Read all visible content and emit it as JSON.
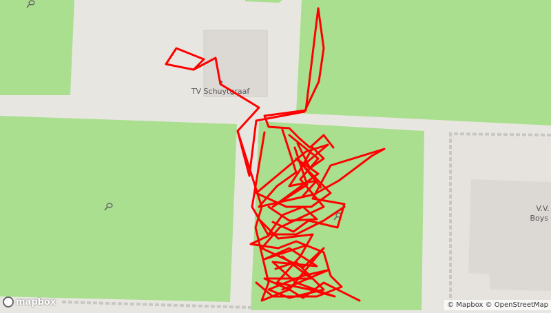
{
  "map": {
    "labels": {
      "club": "TV Schuytgraaf",
      "building": "V.V.",
      "building_2": "Boys S"
    },
    "colors": {
      "grass": "#aadf8f",
      "ground": "#e8e6e1",
      "building": "#dcd9d5",
      "track": "#ff0000",
      "fence": "#c9c7c3"
    },
    "icons": [
      "tennis-racket-icon",
      "tennis-racket-icon",
      "tennis-racket-icon",
      "poi-dot-icon"
    ],
    "attribution": "© Mapbox © OpenStreetMap",
    "logo_text": "mapbox"
  }
}
